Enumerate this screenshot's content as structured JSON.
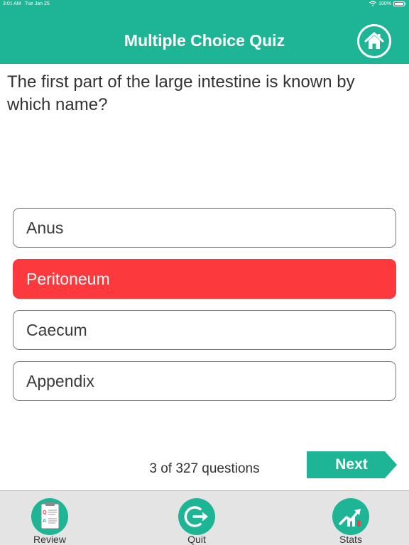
{
  "status_bar": {
    "time": "3:01 AM",
    "date": "Tue Jan 25",
    "battery": "100%",
    "icons": [
      "wifi-icon",
      "battery-icon"
    ]
  },
  "header": {
    "title": "Multiple Choice Quiz",
    "home_icon": "home-icon"
  },
  "quiz": {
    "question": "The first part of the large intestine is known by which name?",
    "answers": [
      {
        "label": "Anus",
        "state": "default"
      },
      {
        "label": "Peritoneum",
        "state": "wrong"
      },
      {
        "label": "Caecum",
        "state": "default"
      },
      {
        "label": "Appendix",
        "state": "default"
      }
    ],
    "progress": "3 of 327 questions",
    "next_label": "Next"
  },
  "tabs": [
    {
      "label": "Review",
      "icon": "clipboard-icon"
    },
    {
      "label": "Quit",
      "icon": "exit-icon"
    },
    {
      "label": "Stats",
      "icon": "chart-trend-icon"
    }
  ],
  "colors": {
    "accent": "#1db595",
    "wrong": "#fc3a3e",
    "tabbar": "#e4e4e4",
    "text": "#333333"
  }
}
